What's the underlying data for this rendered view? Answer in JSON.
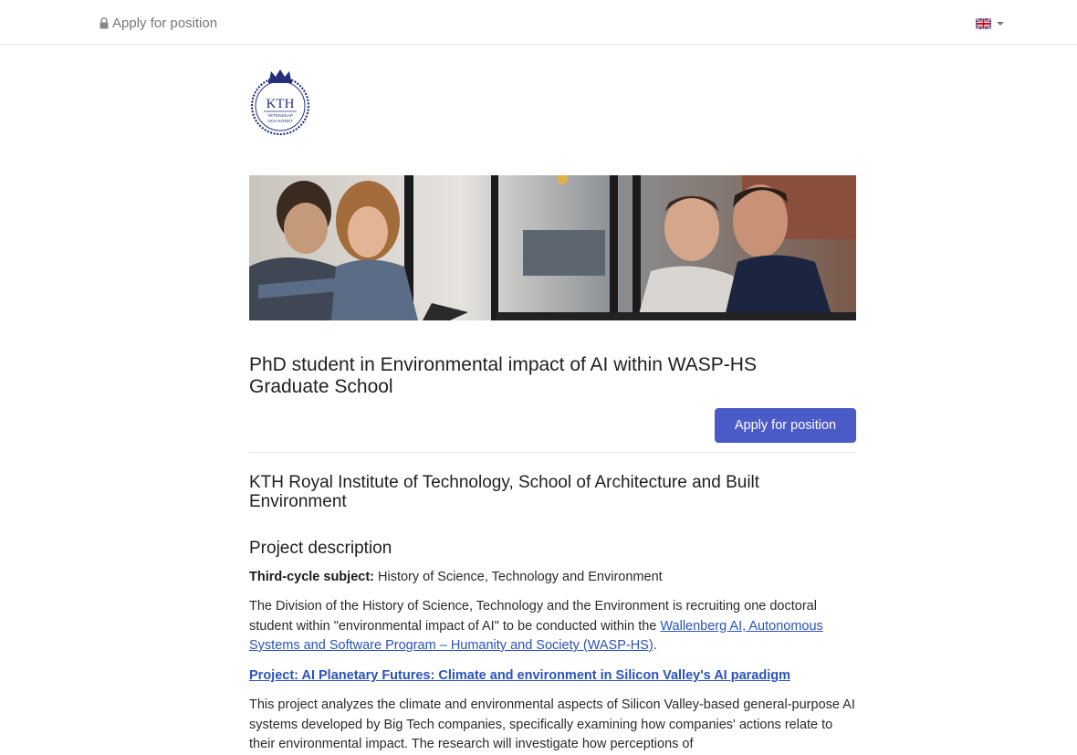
{
  "header": {
    "apply_label": "Apply for position"
  },
  "colors": {
    "accent": "#4a5bc8",
    "link": "#2a52be"
  },
  "job": {
    "title": "PhD student in Environmental impact of AI within WASP-HS Graduate School",
    "apply_button": "Apply for position",
    "organization": "KTH Royal Institute of Technology, School of Architecture and Built Environment"
  },
  "logo": {
    "text": "KTH",
    "subtext_1": "VETENSKAP",
    "subtext_2": "OCH KONST"
  },
  "description": {
    "heading": "Project description",
    "subject_label": "Third-cycle subject:",
    "subject_value": " History of Science, Technology and Environment",
    "intro_text": "The Division of the History of Science, Technology and the Environment is recruiting one doctoral student within \"environmental impact of AI\" to be conducted within the ",
    "intro_link": "Wallenberg AI, Autonomous Systems and Software Program – Humanity and Society (WASP-HS)",
    "intro_end": ".",
    "project_link": "Project: AI Planetary Futures: Climate and environment in Silicon Valley's AI paradigm",
    "project_text": "This project analyzes the climate and environmental aspects of Silicon Valley-based general-purpose AI systems developed by Big Tech companies, specifically examining how companies' actions relate to their environmental impact. The research will investigate how perceptions of"
  }
}
